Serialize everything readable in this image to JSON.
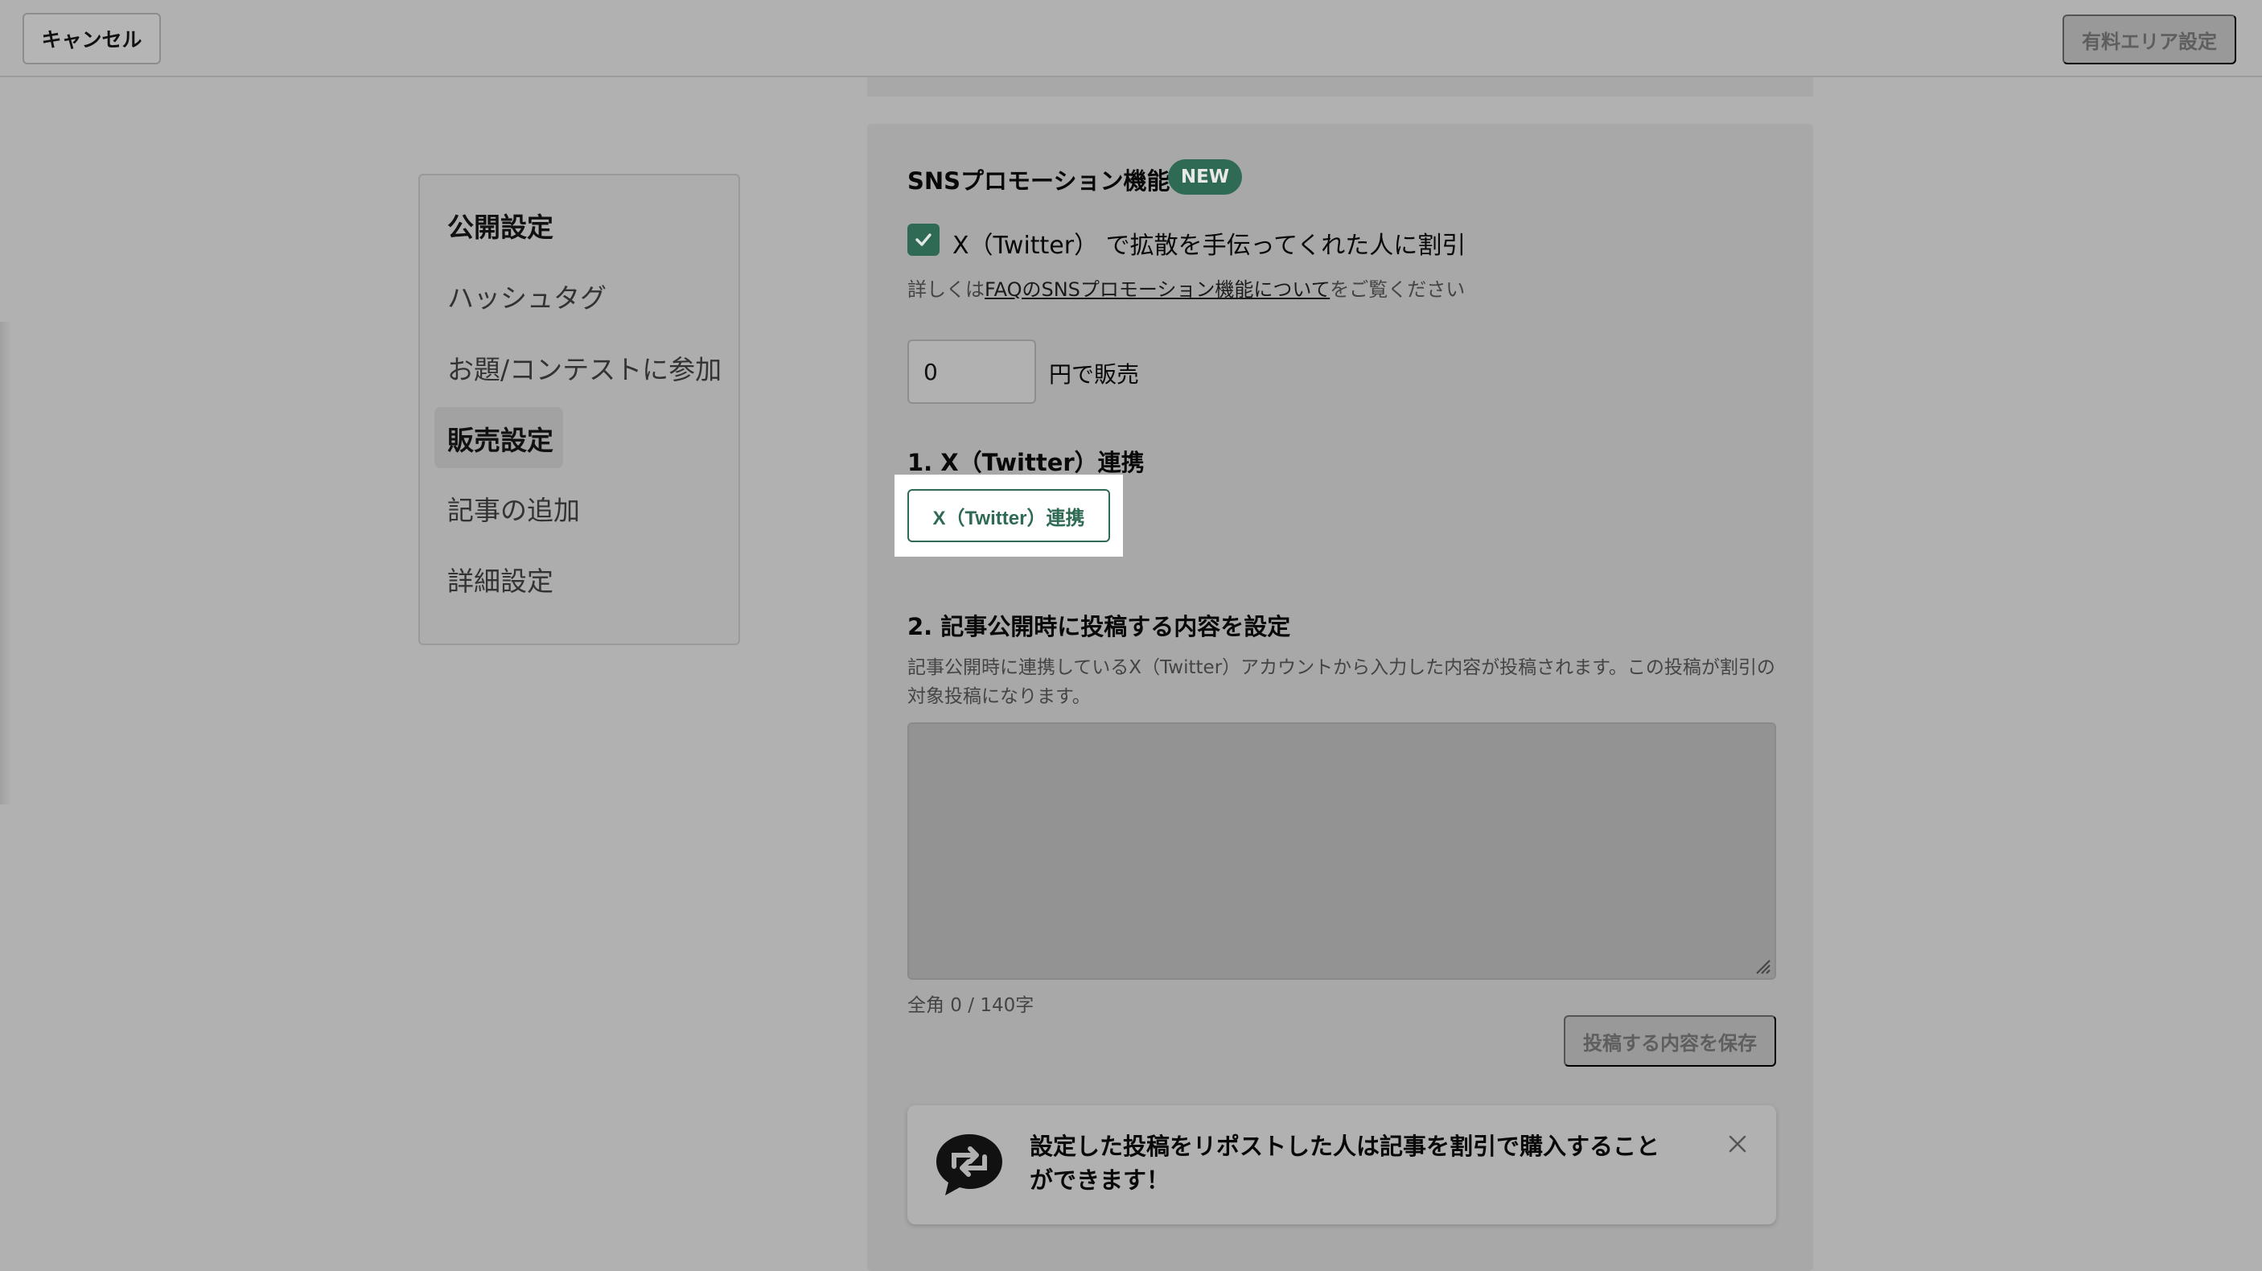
{
  "header": {
    "cancel_label": "キャンセル",
    "paid_area_label": "有料エリア設定"
  },
  "sidebar": {
    "items": [
      {
        "label": "公開設定",
        "bold": true
      },
      {
        "label": "ハッシュタグ"
      },
      {
        "label": "お題/コンテストに参加"
      },
      {
        "label": "販売設定",
        "active": true
      },
      {
        "label": "記事の追加"
      },
      {
        "label": "詳細設定"
      }
    ]
  },
  "sns": {
    "title": "SNSプロモーション機能",
    "badge": "NEW",
    "checkbox_label": "X（Twitter） で拡散を手伝ってくれた人に割引",
    "checkbox_checked": true,
    "faq_prefix": "詳しくは",
    "faq_link": "FAQのSNSプロモーション機能について",
    "faq_suffix": "をご覧ください"
  },
  "price": {
    "value": "0",
    "suffix": "円で販売"
  },
  "step1": {
    "title": "1. X（Twitter）連携",
    "button_label": "X（Twitter）連携"
  },
  "step2": {
    "title": "2. 記事公開時に投稿する内容を設定",
    "description": "記事公開時に連携しているX（Twitter）アカウントから入力した内容が投稿されます。この投稿が割引の対象投稿になります。",
    "textarea_value": "",
    "char_count": "全角 0 / 140字",
    "save_label": "投稿する内容を保存"
  },
  "info_card": {
    "text": "設定した投稿をリポストした人は記事を割引で購入することができます！",
    "icon": "repost-icon"
  },
  "colors": {
    "accent": "#2f6b54",
    "overlay_bg": "#b1b1b1",
    "panel_bg": "#a8a8a8"
  }
}
